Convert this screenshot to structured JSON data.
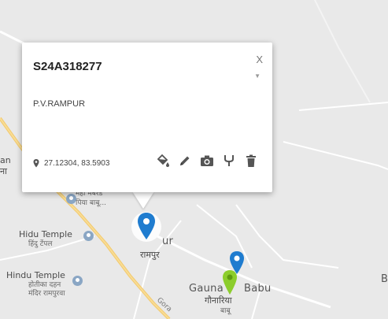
{
  "popup": {
    "title": "S24A318277",
    "subtitle": "P.V.RAMPUR",
    "coords": "27.12304, 83.5903",
    "close_label": "X"
  },
  "map_labels": {
    "left_edge_top": "an",
    "left_edge_bottom": "ना",
    "near_marker_1": "मही मेंबरेड",
    "near_marker_2": "पिया बाबू...",
    "hidu_temple": "Hidu Temple",
    "hidu_temple_hi": "हिंदु टेंपल",
    "hindu_temple": "Hindu Temple",
    "hindu_temple_hi1": "होतीका दहन",
    "hindu_temple_hi2": "मंदिर रामपुरवा",
    "rampur_en": "ur",
    "rampur_hi": "रामपुर",
    "gauna_en": "Gauna",
    "babu_en": "Babu",
    "gauna_hi": "गौनारिया",
    "gauna_hi2": "बाबू",
    "road_label": "Gora",
    "right_edge": "B"
  },
  "colors": {
    "map_bg": "#e9e9e9",
    "road_major": "#f3c96b",
    "road_minor": "#ffffff",
    "marker_blue": "#1f7ccf",
    "marker_green": "#8ccd2c",
    "poi_blue": "#8aa6c4"
  },
  "icons": [
    "pin-icon",
    "paint-bucket-icon",
    "pencil-icon",
    "camera-icon",
    "fork-icon",
    "trash-icon"
  ]
}
